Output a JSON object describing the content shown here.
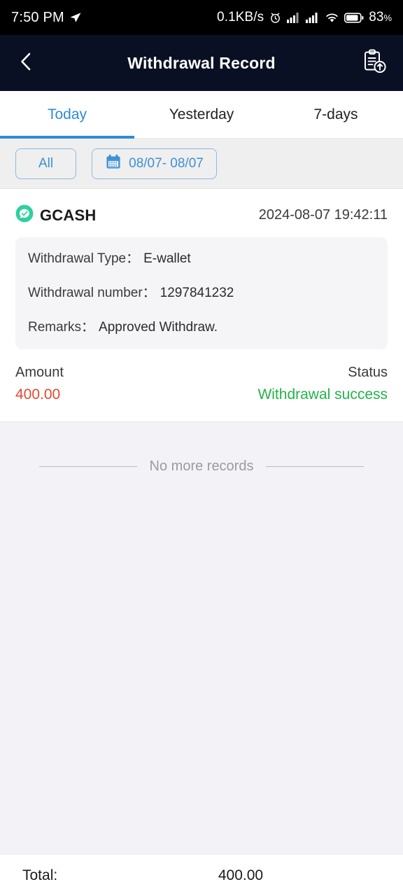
{
  "status_bar": {
    "time": "7:50 PM",
    "location_icon": "navigation-arrow-icon",
    "network_speed": "0.1KB/s",
    "alarm_icon": "alarm-clock-icon",
    "signal_1_icon": "signal-bars-icon",
    "signal_2_icon": "signal-bars-icon",
    "wifi_icon": "wifi-icon",
    "battery_icon": "battery-icon",
    "battery_level": "83",
    "battery_unit": "%"
  },
  "header": {
    "back_icon": "chevron-left-icon",
    "title": "Withdrawal Record",
    "action_icon": "clipboard-upload-icon"
  },
  "tabs": [
    {
      "label": "Today",
      "active": true
    },
    {
      "label": "Yesterday",
      "active": false
    },
    {
      "label": "7-days",
      "active": false
    }
  ],
  "filters": {
    "all_label": "All",
    "calendar_icon": "calendar-icon",
    "date_range": "08/07- 08/07"
  },
  "records": [
    {
      "brand_icon": "gcash-logo-icon",
      "brand": "GCASH",
      "timestamp": "2024-08-07 19:42:11",
      "details": [
        {
          "label": "Withdrawal Type：",
          "value": "E-wallet"
        },
        {
          "label": "Withdrawal number：",
          "value": "1297841232"
        },
        {
          "label": "Remarks：",
          "value": "Approved Withdraw."
        }
      ],
      "amount_label": "Amount",
      "amount_value": "400.00",
      "status_label": "Status",
      "status_value": "Withdrawal success"
    }
  ],
  "list_end": {
    "text": "No more records"
  },
  "total_bar": {
    "label": "Total:",
    "value": "400.00"
  },
  "colors": {
    "header_bg": "#0A1024",
    "accent_blue": "#2E8BD8",
    "amount_red": "#E04A2F",
    "status_green": "#23B34A",
    "page_bg": "#F3F3F7",
    "brand_green": "#2ED0A0"
  }
}
